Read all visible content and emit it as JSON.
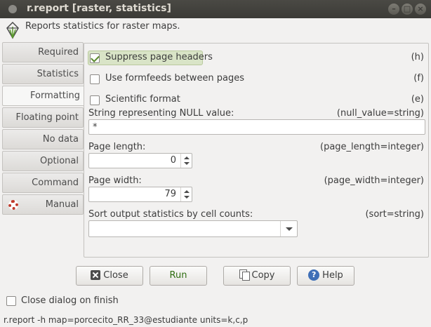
{
  "window": {
    "title": "r.report [raster, statistics]",
    "controls": [
      "minimize-icon",
      "maximize-icon",
      "close-icon"
    ]
  },
  "header": {
    "description": "Reports statistics for raster maps."
  },
  "tabs": [
    {
      "label": "Required",
      "active": false
    },
    {
      "label": "Statistics",
      "active": false
    },
    {
      "label": "Formatting",
      "active": true
    },
    {
      "label": "Floating point",
      "active": false
    },
    {
      "label": "No data",
      "active": false
    },
    {
      "label": "Optional",
      "active": false
    },
    {
      "label": "Command output",
      "active": false
    },
    {
      "label": "Manual",
      "active": false,
      "icon": "lifering-icon"
    }
  ],
  "formatting": {
    "suppress_headers": {
      "label": "Suppress page headers",
      "flag": "(h)",
      "checked": true
    },
    "formfeeds": {
      "label": "Use formfeeds between pages",
      "flag": "(f)",
      "checked": false
    },
    "scientific": {
      "label": "Scientific format",
      "flag": "(e)",
      "checked": false
    },
    "null_value": {
      "label": "String representing NULL value:",
      "type": "(null_value=string)",
      "value": "*"
    },
    "page_length": {
      "label": "Page length:",
      "type": "(page_length=integer)",
      "value": "0"
    },
    "page_width": {
      "label": "Page width:",
      "type": "(page_width=integer)",
      "value": "79"
    },
    "sort": {
      "label": "Sort output statistics by cell counts:",
      "type": "(sort=string)",
      "value": ""
    }
  },
  "buttons": {
    "close": "Close",
    "run": "Run",
    "copy": "Copy",
    "help": "Help"
  },
  "close_on_finish": {
    "label": "Close dialog on finish",
    "checked": false
  },
  "command_line": "r.report -h map=porcecito_RR_33@estudiante units=k,c,p",
  "colors": {
    "titlebar": "#3c3b37",
    "window_bg": "#f2f1f0",
    "run_text": "#2f6e11",
    "highlight": "#d9e4c7"
  }
}
